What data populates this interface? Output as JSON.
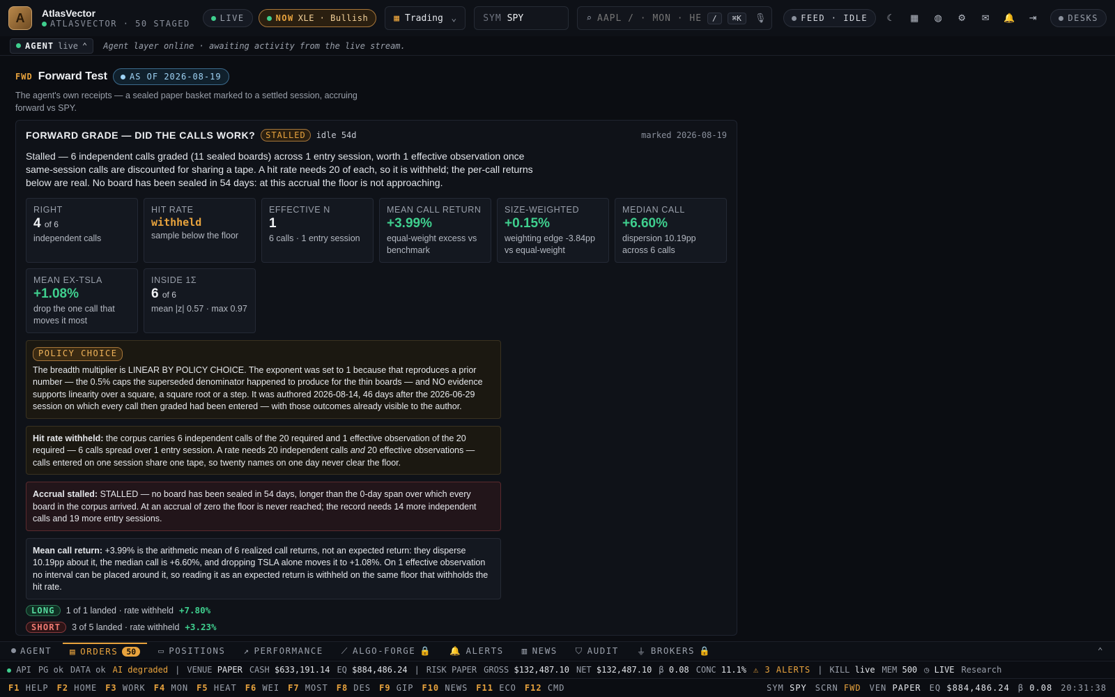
{
  "app": {
    "name": "AtlasVector",
    "sub": "ATLASVECTOR · 50 STAGED",
    "logo_letter": "A"
  },
  "top": {
    "live": "LIVE",
    "now_label": "NOW",
    "now_value": "XLE · Bullish",
    "workspace": "Trading",
    "sym_label": "SYM",
    "sym_value": "SPY",
    "search_placeholder": "AAPL / · MON · HEAT",
    "search_kbd1": "/",
    "search_kbd2": "⌘K",
    "feed": "FEED · IDLE",
    "desks": "DESKS"
  },
  "agent": {
    "label": "AGENT",
    "state": "live",
    "message": "Agent layer online · awaiting activity from the live stream."
  },
  "page": {
    "tag": "FWD",
    "title": "Forward Test",
    "asof": "AS OF 2026-08-19",
    "desc": "The agent's own receipts — a sealed paper basket marked to a settled session, accruing forward vs SPY."
  },
  "grade": {
    "title": "FORWARD GRADE — DID THE CALLS WORK?",
    "badge": "STALLED",
    "idle": "idle 54d",
    "marked": "marked 2026-08-19",
    "summary": "Stalled — 6 independent calls graded (11 sealed boards) across 1 entry session, worth 1 effective observation once same-session calls are discounted for sharing a tape. A hit rate needs 20 of each, so it is withheld; the per-call returns below are real. No board has been sealed in 54 days: at this accrual the floor is not approaching."
  },
  "stats": [
    {
      "label": "RIGHT",
      "value": "4",
      "suffix": "of 6",
      "sub": "independent calls",
      "tone": "white"
    },
    {
      "label": "HIT RATE",
      "value": "withheld",
      "suffix": "",
      "sub": "sample below the floor",
      "tone": "amber"
    },
    {
      "label": "EFFECTIVE N",
      "value": "1",
      "suffix": "",
      "sub": "6 calls · 1 entry session",
      "tone": "white"
    },
    {
      "label": "MEAN CALL RETURN",
      "value": "+3.99%",
      "suffix": "",
      "sub": "equal-weight excess vs benchmark",
      "tone": "green"
    },
    {
      "label": "SIZE-WEIGHTED",
      "value": "+0.15%",
      "suffix": "",
      "sub": "weighting edge -3.84pp vs equal-weight",
      "tone": "green"
    },
    {
      "label": "MEDIAN CALL",
      "value": "+6.60%",
      "suffix": "",
      "sub": "dispersion 10.19pp across 6 calls",
      "tone": "green"
    },
    {
      "label": "MEAN EX-TSLA",
      "value": "+1.08%",
      "suffix": "",
      "sub": "drop the one call that moves it most",
      "tone": "green"
    },
    {
      "label": "INSIDE 1Σ",
      "value": "6",
      "suffix": "of 6",
      "sub": "mean |z| 0.57 · max 0.97",
      "tone": "white"
    }
  ],
  "policy": {
    "tag": "POLICY CHOICE",
    "text": "The breadth multiplier is LINEAR BY POLICY CHOICE. The exponent was set to 1 because that reproduces a prior number — the 0.5% caps the superseded denominator happened to produce for the thin boards — and NO evidence supports linearity over a square, a square root or a step. It was authored 2026-08-14, 46 days after the 2026-06-29 session on which every call then graded had been entered — with those outcomes already visible to the author."
  },
  "notes": {
    "hit_title": "Hit rate withheld:",
    "hit_a": " the corpus carries 6 independent calls of the 20 required and 1 effective observation of the 20 required — 6 calls spread over 1 entry session. A rate needs 20 independent calls ",
    "hit_em": "and",
    "hit_b": " 20 effective observations — calls entered on one session share one tape, so twenty names on one day never clear the floor.",
    "accrual_title": "Accrual stalled:",
    "accrual_text": " STALLED — no board has been sealed in 54 days, longer than the 0-day span over which every board in the corpus arrived. At an accrual of zero the floor is never reached; the record needs 14 more independent calls and 19 more entry sessions.",
    "mean_title": "Mean call return:",
    "mean_text": " +3.99% is the arithmetic mean of 6 realized call returns, not an expected return: they disperse 10.19pp about it, the median call is +6.60%, and dropping TSLA alone moves it to +1.08%. On 1 effective observation no interval can be placed around it, so reading it as an expected return is withheld on the same floor that withholds the hit rate."
  },
  "legs": [
    {
      "tag": "LONG",
      "text": "1 of 1 landed · rate withheld",
      "ret": "+7.80%"
    },
    {
      "tag": "SHORT",
      "text": "3 of 5 landed · rate withheld",
      "ret": "+3.23%"
    }
  ],
  "tabs": [
    {
      "label": "AGENT"
    },
    {
      "label": "ORDERS",
      "count": "50"
    },
    {
      "label": "POSITIONS"
    },
    {
      "label": "PERFORMANCE"
    },
    {
      "label": "ALGO-FORGE"
    },
    {
      "label": "ALERTS"
    },
    {
      "label": "NEWS"
    },
    {
      "label": "AUDIT"
    },
    {
      "label": "BROKERS"
    }
  ],
  "status": {
    "api": "API",
    "pg": "PG ok",
    "data": "DATA ok",
    "ai": "AI degraded",
    "venue_l": "VENUE",
    "venue": "PAPER",
    "cash_l": "CASH",
    "cash": "$633,191.14",
    "eq_l": "EQ",
    "eq": "$884,486.24",
    "risk_l": "RISK",
    "risk": "PAPER",
    "gross_l": "GROSS",
    "gross": "$132,487.10",
    "net_l": "NET",
    "net": "$132,487.10",
    "beta_l": "β",
    "beta": "0.08",
    "conc_l": "CONC",
    "conc": "11.1%",
    "alerts": "⚠ 3 ALERTS",
    "kill_l": "KILL",
    "kill": "live",
    "mem_l": "MEM",
    "mem": "500",
    "live": "LIVE",
    "research": "Research"
  },
  "fkeys": [
    {
      "k": "F1",
      "v": "HELP"
    },
    {
      "k": "F2",
      "v": "HOME"
    },
    {
      "k": "F3",
      "v": "WORK"
    },
    {
      "k": "F4",
      "v": "MON"
    },
    {
      "k": "F5",
      "v": "HEAT"
    },
    {
      "k": "F6",
      "v": "WEI"
    },
    {
      "k": "F7",
      "v": "MOST"
    },
    {
      "k": "F8",
      "v": "DES"
    },
    {
      "k": "F9",
      "v": "GIP"
    },
    {
      "k": "F10",
      "v": "NEWS"
    },
    {
      "k": "F11",
      "v": "ECO"
    },
    {
      "k": "F12",
      "v": "CMD"
    }
  ],
  "fright": {
    "sym_l": "SYM",
    "sym": "SPY",
    "scrn_l": "SCRN",
    "scrn": "FWD",
    "ven_l": "VEN",
    "ven": "PAPER",
    "eq_l": "EQ",
    "eq": "$884,486.24",
    "beta_l": "β",
    "beta": "0.08",
    "time": "20:31:38"
  },
  "colors": {
    "accent": "#e8a33d",
    "positive": "#3fcf8e",
    "negative": "#e5534b",
    "info": "#9fd3f5"
  }
}
